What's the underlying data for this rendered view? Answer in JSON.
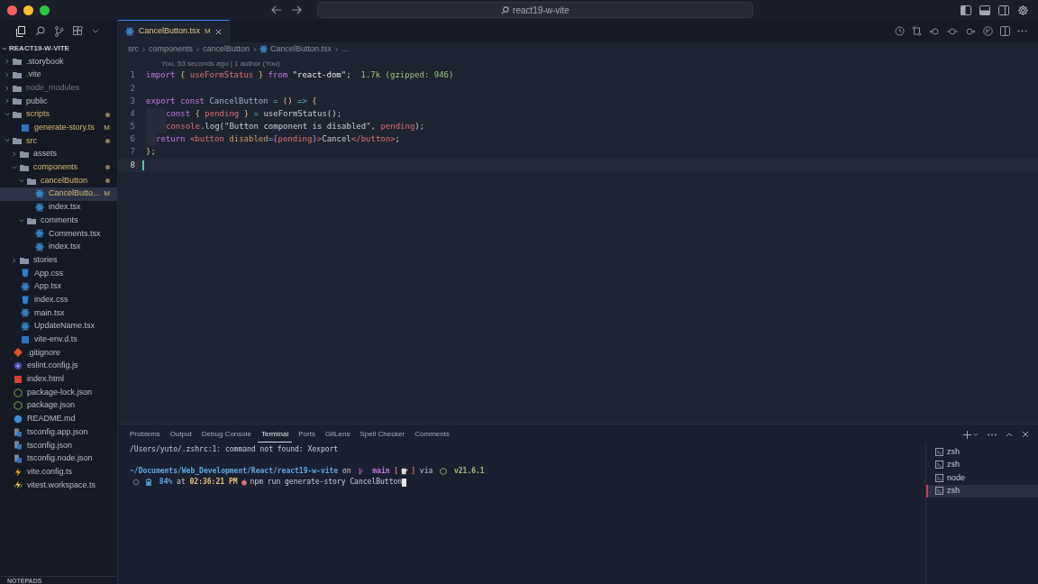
{
  "window": {
    "search": "react19-w-vite"
  },
  "explorer": {
    "title": "REACT19-W-VITE",
    "items": [
      {
        "name": ".storybook",
        "kind": "folder",
        "expanded": false,
        "modified": false,
        "dot": false,
        "dimmed": false,
        "selected": false
      },
      {
        "name": ".vite",
        "kind": "folder",
        "expanded": false,
        "modified": false,
        "dot": false,
        "dimmed": false,
        "selected": false
      },
      {
        "name": "node_modules",
        "kind": "folder",
        "expanded": false,
        "modified": false,
        "dot": false,
        "dimmed": true,
        "selected": false
      },
      {
        "name": "public",
        "kind": "folder",
        "expanded": false,
        "modified": false,
        "dot": false,
        "dimmed": false,
        "selected": false
      },
      {
        "name": "scripts",
        "kind": "folder",
        "expanded": true,
        "modified": true,
        "dot": true,
        "dimmed": false,
        "selected": false,
        "children": [
          {
            "name": "generate-story.ts",
            "kind": "ts",
            "badge": "M",
            "modified": true,
            "dot": false,
            "dimmed": false,
            "selected": false
          }
        ]
      },
      {
        "name": "src",
        "kind": "folder",
        "expanded": true,
        "modified": true,
        "dot": true,
        "dimmed": false,
        "selected": false,
        "children": [
          {
            "name": "assets",
            "kind": "folder",
            "expanded": false,
            "modified": false,
            "dot": false,
            "dimmed": false,
            "selected": false
          },
          {
            "name": "components",
            "kind": "folder",
            "expanded": true,
            "modified": true,
            "dot": true,
            "dimmed": false,
            "selected": false,
            "children": [
              {
                "name": "cancelButton",
                "kind": "folder",
                "expanded": true,
                "modified": true,
                "dot": true,
                "dimmed": false,
                "selected": false,
                "children": [
                  {
                    "name": "CancelButto...",
                    "kind": "react",
                    "badge": "M",
                    "modified": true,
                    "dot": false,
                    "dimmed": false,
                    "selected": true
                  },
                  {
                    "name": "index.tsx",
                    "kind": "react",
                    "modified": false,
                    "dot": false,
                    "dimmed": false,
                    "selected": false
                  }
                ]
              },
              {
                "name": "comments",
                "kind": "folder",
                "expanded": true,
                "modified": false,
                "dot": false,
                "dimmed": false,
                "selected": false,
                "children": [
                  {
                    "name": "Comments.tsx",
                    "kind": "react",
                    "modified": false,
                    "dot": false,
                    "dimmed": false,
                    "selected": false
                  },
                  {
                    "name": "index.tsx",
                    "kind": "react",
                    "modified": false,
                    "dot": false,
                    "dimmed": false,
                    "selected": false
                  }
                ]
              }
            ]
          },
          {
            "name": "stories",
            "kind": "folder",
            "expanded": false,
            "modified": false,
            "dot": false,
            "dimmed": false,
            "selected": false
          },
          {
            "name": "App.css",
            "kind": "css",
            "modified": false,
            "dot": false,
            "dimmed": false,
            "selected": false
          },
          {
            "name": "App.tsx",
            "kind": "react",
            "modified": false,
            "dot": false,
            "dimmed": false,
            "selected": false
          },
          {
            "name": "index.css",
            "kind": "css",
            "modified": false,
            "dot": false,
            "dimmed": false,
            "selected": false
          },
          {
            "name": "main.tsx",
            "kind": "react",
            "modified": false,
            "dot": false,
            "dimmed": false,
            "selected": false
          },
          {
            "name": "UpdateName.tsx",
            "kind": "react",
            "modified": false,
            "dot": false,
            "dimmed": false,
            "selected": false
          },
          {
            "name": "vite-env.d.ts",
            "kind": "ts",
            "modified": false,
            "dot": false,
            "dimmed": false,
            "selected": false
          }
        ]
      },
      {
        "name": ".gitignore",
        "kind": "git",
        "modified": false,
        "dot": false,
        "dimmed": false,
        "selected": false
      },
      {
        "name": "eslint.config.js",
        "kind": "eslint",
        "modified": false,
        "dot": false,
        "dimmed": false,
        "selected": false
      },
      {
        "name": "index.html",
        "kind": "html",
        "modified": false,
        "dot": false,
        "dimmed": false,
        "selected": false
      },
      {
        "name": "package-lock.json",
        "kind": "node",
        "modified": false,
        "dot": false,
        "dimmed": false,
        "selected": false
      },
      {
        "name": "package.json",
        "kind": "node",
        "modified": false,
        "dot": false,
        "dimmed": false,
        "selected": false
      },
      {
        "name": "README.md",
        "kind": "md",
        "modified": false,
        "dot": false,
        "dimmed": false,
        "selected": false
      },
      {
        "name": "tsconfig.app.json",
        "kind": "tsconfig",
        "modified": false,
        "dot": false,
        "dimmed": false,
        "selected": false
      },
      {
        "name": "tsconfig.json",
        "kind": "tsconfig",
        "modified": false,
        "dot": false,
        "dimmed": false,
        "selected": false
      },
      {
        "name": "tsconfig.node.json",
        "kind": "tsconfig",
        "modified": false,
        "dot": false,
        "dimmed": false,
        "selected": false
      },
      {
        "name": "vite.config.ts",
        "kind": "vite",
        "modified": false,
        "dot": false,
        "dimmed": false,
        "selected": false
      },
      {
        "name": "vitest.workspace.ts",
        "kind": "vitest",
        "modified": false,
        "dot": false,
        "dimmed": false,
        "selected": false
      }
    ],
    "footer": "NOTEPADS"
  },
  "tabs": [
    {
      "label": "CancelButton.tsx",
      "badge": "M",
      "selected": true
    }
  ],
  "breadcrumbs": [
    "src",
    "components",
    "cancelButton",
    "CancelButton.tsx",
    "..."
  ],
  "blame": "You, 53 seconds ago | 1 author (You)",
  "code": [
    {
      "number": "1",
      "tokens": [
        {
          "kind": "kw",
          "text": "import "
        },
        {
          "kind": "brace",
          "text": "{ "
        },
        {
          "kind": "var",
          "text": "useFormStatus"
        },
        {
          "kind": "brace",
          "text": " } "
        },
        {
          "kind": "kw",
          "text": "from "
        },
        {
          "kind": "str",
          "text": "\"react-dom\""
        },
        {
          "kind": "plain",
          "text": ";  "
        },
        {
          "kind": "hint",
          "text": "1.7k (gzipped: 946)"
        }
      ]
    },
    {
      "number": "2"
    },
    {
      "number": "3",
      "tokens": [
        {
          "kind": "kw",
          "text": "export const "
        },
        {
          "kind": "name",
          "text": "CancelButton "
        },
        {
          "kind": "op",
          "text": "= "
        },
        {
          "kind": "brace",
          "text": "() "
        },
        {
          "kind": "op",
          "text": "=> "
        },
        {
          "kind": "brace",
          "text": "{"
        }
      ]
    },
    {
      "number": "4",
      "kind": "deep",
      "tokens": [
        {
          "kind": "kw",
          "text": "const "
        },
        {
          "kind": "brace",
          "text": "{ "
        },
        {
          "kind": "var",
          "text": "pending"
        },
        {
          "kind": "brace",
          "text": " } "
        },
        {
          "kind": "op",
          "text": "= "
        },
        {
          "kind": "plain",
          "text": "useFormStatus();"
        }
      ]
    },
    {
      "number": "5",
      "kind": "deep",
      "tokens": [
        {
          "kind": "var",
          "text": "console"
        },
        {
          "kind": "plain",
          "text": ".log(\"Button component is disabled\", "
        },
        {
          "kind": "var",
          "text": "pending"
        },
        {
          "kind": "plain",
          "text": ");"
        }
      ]
    },
    {
      "number": "6",
      "kind": "shallow",
      "tokens": [
        {
          "kind": "kw",
          "text": "return "
        },
        {
          "kind": "tag",
          "text": "<button "
        },
        {
          "kind": "attr",
          "text": "disabled"
        },
        {
          "kind": "op",
          "text": "="
        },
        {
          "kind": "kw",
          "text": "{"
        },
        {
          "kind": "var",
          "text": "pending"
        },
        {
          "kind": "kw",
          "text": "}"
        },
        {
          "kind": "tag",
          "text": ">"
        },
        {
          "kind": "plain",
          "text": "Cancel"
        },
        {
          "kind": "tag",
          "text": "</button>"
        },
        {
          "kind": "plain",
          "text": ";"
        }
      ]
    },
    {
      "number": "7",
      "tokens": [
        {
          "kind": "brace",
          "text": "}"
        },
        {
          "kind": "plain",
          "text": ";"
        }
      ]
    },
    {
      "number": "8",
      "current": true
    }
  ],
  "panel": {
    "tabs": [
      {
        "label": "Problems",
        "selected": false
      },
      {
        "label": "Output",
        "selected": false
      },
      {
        "label": "Debug Console",
        "selected": false
      },
      {
        "label": "Terminal",
        "selected": true
      },
      {
        "label": "Ports",
        "selected": false
      },
      {
        "label": "GitLens",
        "selected": false
      },
      {
        "label": "Spell Checker",
        "selected": false
      },
      {
        "label": "Comments",
        "selected": false
      }
    ],
    "terminal": [
      {
        "tokens": [
          {
            "kind": "plain",
            "text": "/Users/yuto/.zshrc:1: command not found: Xexport"
          }
        ]
      },
      {
        "tokens": [
          {
            "kind": "path",
            "text": "~/Documents/Web_Development/React/react19-w-vite"
          },
          {
            "kind": "plain",
            "text": " on "
          },
          {
            "kind": "branch-icon"
          },
          {
            "kind": "branch",
            "text": " main "
          },
          {
            "kind": "status",
            "text": "["
          },
          {
            "kind": "memo-icon"
          },
          {
            "kind": "status",
            "text": "]"
          },
          {
            "kind": "plain",
            "text": " via "
          },
          {
            "kind": "node-icon"
          },
          {
            "kind": "version",
            "text": " v21.6.1"
          }
        ]
      },
      {
        "tokens": [
          {
            "kind": "prompt-icon"
          },
          {
            "kind": "battery-icon"
          },
          {
            "kind": "path",
            "text": " 84%"
          },
          {
            "kind": "plain",
            "text": " at "
          },
          {
            "kind": "time",
            "text": "02:36:21 PM"
          },
          {
            "kind": "apple-icon"
          },
          {
            "kind": "plain",
            "text": "npm run generate-story CancelButton"
          },
          {
            "kind": "cursor"
          }
        ]
      }
    ],
    "shells": [
      {
        "label": "zsh",
        "selected": false
      },
      {
        "label": "zsh",
        "selected": false
      },
      {
        "label": "node",
        "selected": false
      },
      {
        "label": "zsh",
        "selected": true
      }
    ]
  }
}
